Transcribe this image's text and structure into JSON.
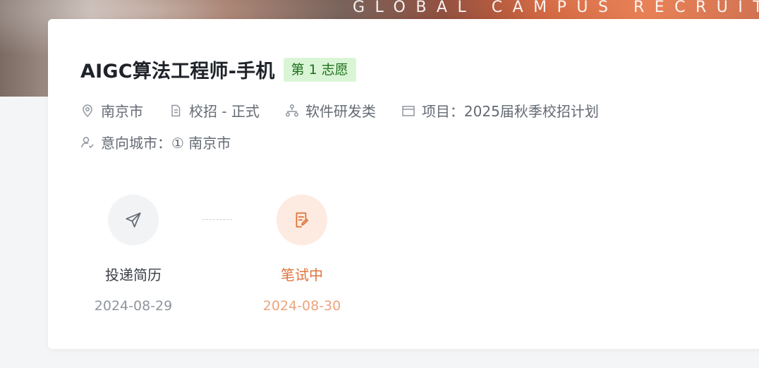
{
  "banner": {
    "text": "GLOBAL CAMPUS RECRUITMENT"
  },
  "job": {
    "title": "AIGC算法工程师-手机",
    "preference_badge": "第 1 志愿",
    "location": "南京市",
    "recruit_type": "校招 - 正式",
    "category": "软件研发类",
    "project": "项目：2025届秋季校招计划",
    "intended_city": "意向城市：① 南京市"
  },
  "progress": {
    "steps": [
      {
        "label": "投递简历",
        "date": "2024-08-29",
        "icon": "send-icon",
        "status": "done"
      },
      {
        "label": "笔试中",
        "date": "2024-08-30",
        "icon": "exam-icon",
        "status": "current"
      }
    ]
  },
  "colors": {
    "accent": "#e07339",
    "badge_bg": "#d9f5d6",
    "badge_text": "#1e6f1a"
  }
}
